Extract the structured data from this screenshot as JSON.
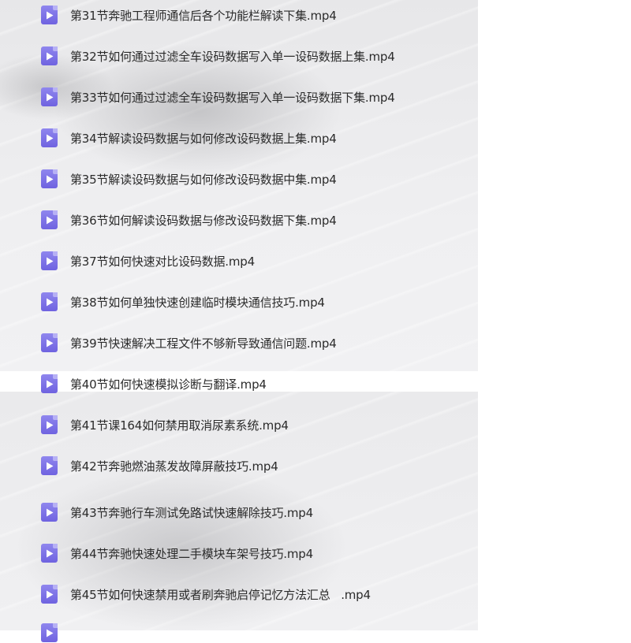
{
  "files": [
    {
      "name": "第31节奔驰工程师通信后各个功能栏解读下集.mp4"
    },
    {
      "name": "第32节如何通过过滤全车设码数据写入单一设码数据上集.mp4"
    },
    {
      "name": "第33节如何通过过滤全车设码数据写入单一设码数据下集.mp4"
    },
    {
      "name": "第34节解读设码数据与如何修改设码数据上集.mp4"
    },
    {
      "name": "第35节解读设码数据与如何修改设码数据中集.mp4"
    },
    {
      "name": "第36节如何解读设码数据与修改设码数据下集.mp4"
    },
    {
      "name": "第37节如何快速对比设码数据.mp4"
    },
    {
      "name": "第38节如何单独快速创建临时模块通信技巧.mp4"
    },
    {
      "name": "第39节快速解决工程文件不够新导致通信问题.mp4"
    },
    {
      "name": "第40节如何快速模拟诊断与翻译.mp4"
    },
    {
      "name": "第41节课164如何禁用取消尿素系统.mp4"
    },
    {
      "name": "第42节奔驰燃油蒸发故障屏蔽技巧.mp4"
    },
    {
      "name": "第43节奔驰行车测试免路试快速解除技巧.mp4"
    },
    {
      "name": "第44节奔驰快速处理二手模块车架号技巧.mp4"
    },
    {
      "name": "第45节如何快速禁用或者刷奔驰启停记忆方法汇总   .mp4"
    }
  ],
  "icon": {
    "type": "video-file-icon",
    "color": "#7b6fe6"
  }
}
